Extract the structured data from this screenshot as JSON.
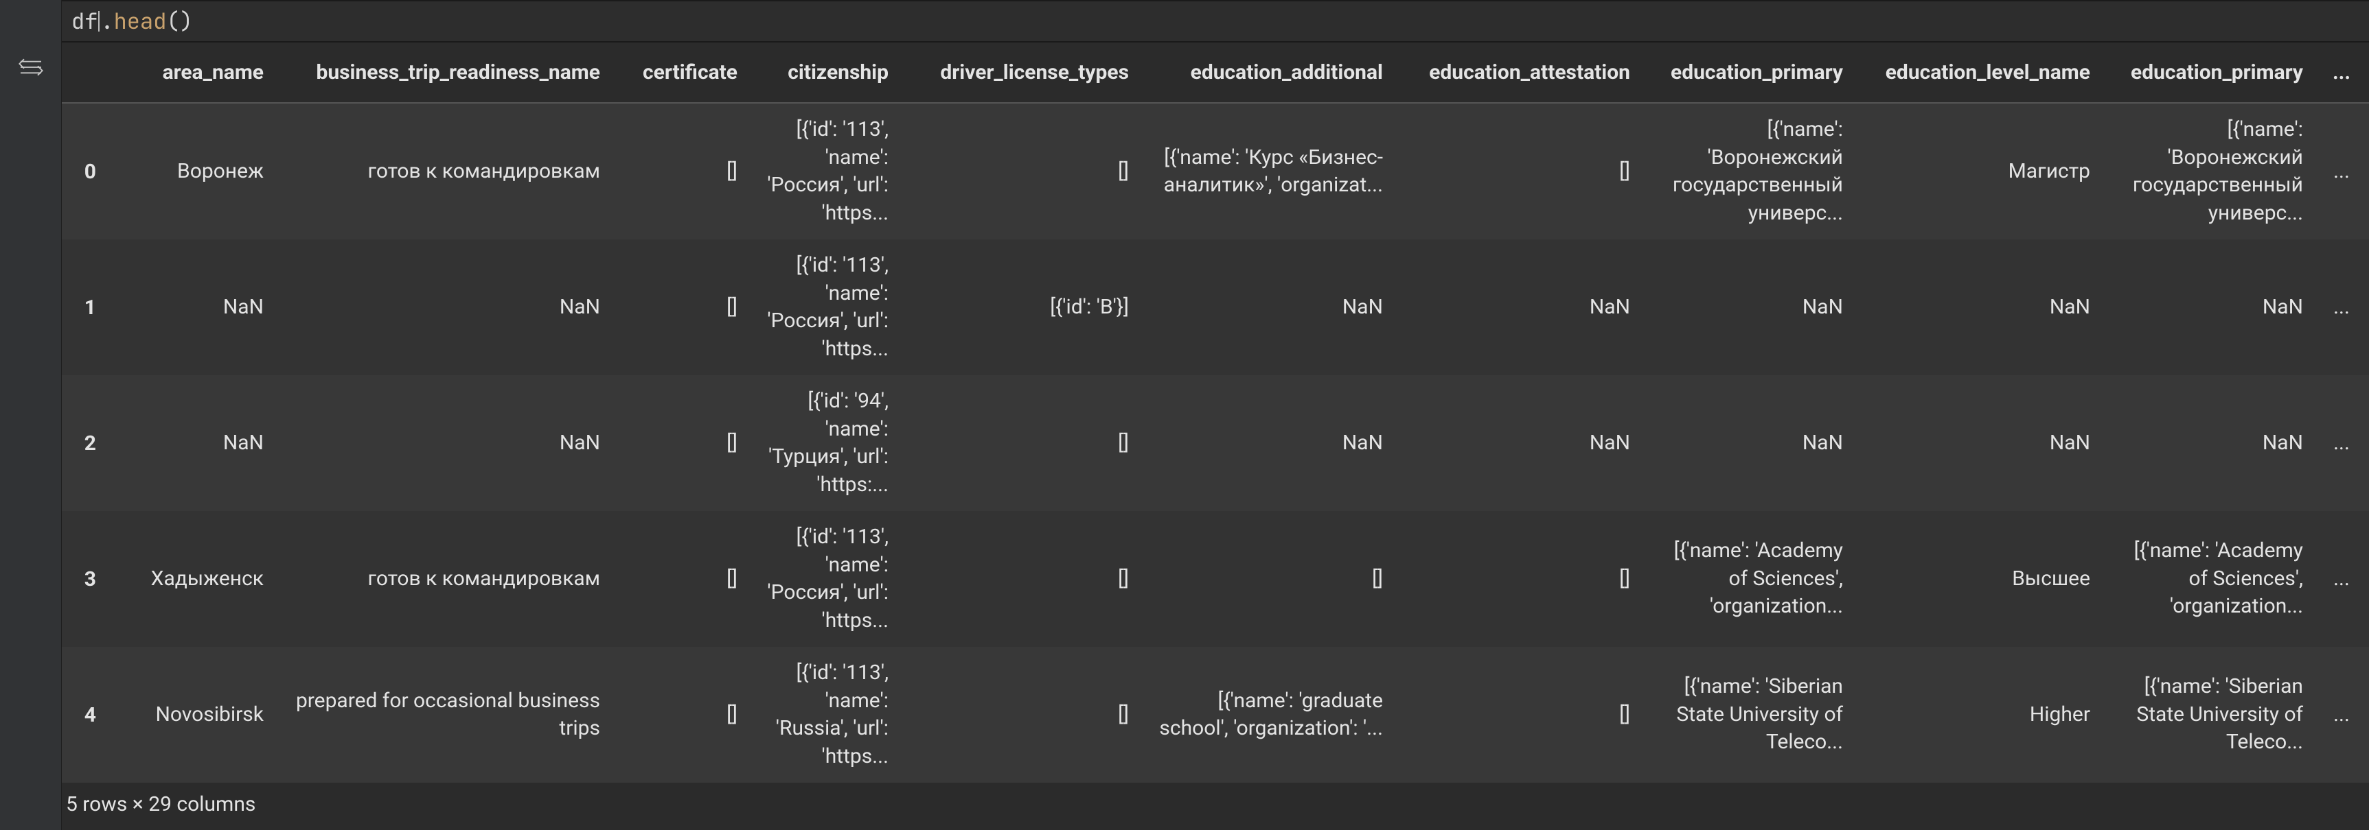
{
  "code": {
    "ident": "df",
    "func": "head",
    "parens": "()"
  },
  "table": {
    "columns": [
      "area_name",
      "business_trip_readiness_name",
      "certificate",
      "citizenship",
      "driver_license_types",
      "education_additional",
      "education_attestation",
      "education_primary",
      "education_level_name",
      "education_primary"
    ],
    "ellipsis": "...",
    "rows": [
      {
        "idx": "0",
        "cells": [
          "Воронеж",
          "готов к командировкам",
          "[]",
          "[{'id': '113', 'name': 'Россия', 'url': 'https...",
          "[]",
          "[{'name': 'Курс «Бизнес-аналитик»', 'organizat...",
          "[]",
          "[{'name': 'Воронежский государственный универс...",
          "Магистр",
          "[{'name': 'Воронежский государственный универс...",
          "..."
        ]
      },
      {
        "idx": "1",
        "cells": [
          "NaN",
          "NaN",
          "[]",
          "[{'id': '113', 'name': 'Россия', 'url': 'https...",
          "[{'id': 'B'}]",
          "NaN",
          "NaN",
          "NaN",
          "NaN",
          "NaN",
          "..."
        ]
      },
      {
        "idx": "2",
        "cells": [
          "NaN",
          "NaN",
          "[]",
          "[{'id': '94', 'name': 'Турция', 'url': 'https:...",
          "[]",
          "NaN",
          "NaN",
          "NaN",
          "NaN",
          "NaN",
          "..."
        ]
      },
      {
        "idx": "3",
        "cells": [
          "Хадыженск",
          "готов к командировкам",
          "[]",
          "[{'id': '113', 'name': 'Россия', 'url': 'https...",
          "[]",
          "[]",
          "[]",
          "[{'name': 'Academy of Sciences', 'organization...",
          "Высшее",
          "[{'name': 'Academy of Sciences', 'organization...",
          "..."
        ]
      },
      {
        "idx": "4",
        "cells": [
          "Novosibirsk",
          "prepared for occasional business trips",
          "[]",
          "[{'id': '113', 'name': 'Russia', 'url': 'https...",
          "[]",
          "[{'name': 'graduate school', 'organization': '...",
          "[]",
          "[{'name': 'Siberian State University of Teleco...",
          "Higher",
          "[{'name': 'Siberian State University of Teleco...",
          "..."
        ]
      }
    ]
  },
  "footer": "5 rows × 29 columns"
}
